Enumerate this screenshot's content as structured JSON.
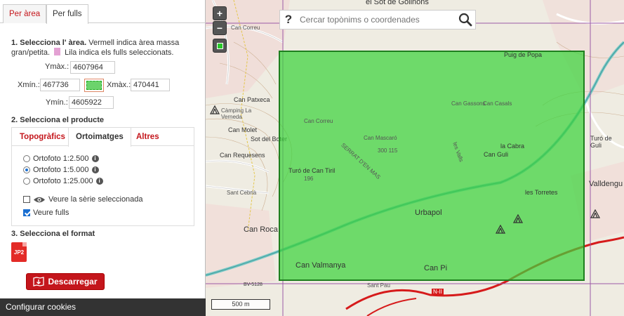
{
  "tabs": {
    "by_area": "Per àrea",
    "by_sheets": "Per fulls"
  },
  "step1": {
    "title": "1. Selecciona l' àrea.",
    "desc": "Vermell indica àrea massa gran/petita.",
    "desc2": "Lila indica els fulls seleccionats."
  },
  "coords": {
    "ymax_label": "Ymàx.:",
    "ymax": "4607964",
    "xmin_label": "Xmín.:",
    "xmin": "467736",
    "xmax_label": "Xmàx.:",
    "xmax": "470441",
    "ymin_label": "Ymín.:",
    "ymin": "4605922"
  },
  "step2": {
    "title": "2. Selecciona el producte"
  },
  "product_tabs": [
    "Topogràfics",
    "Ortoimatges",
    "Altres"
  ],
  "options": [
    {
      "label": "Ortofoto 1:2.500",
      "selected": false
    },
    {
      "label": "Ortofoto 1:5.000",
      "selected": true
    },
    {
      "label": "Ortofoto 1:25.000",
      "selected": false
    }
  ],
  "show_series": {
    "label": "Veure la sèrie seleccionada",
    "checked": false
  },
  "show_sheets": {
    "label": "Veure fulls",
    "checked": true
  },
  "step3": {
    "title": "3. Selecciona el format"
  },
  "format": {
    "label": "JP2"
  },
  "download": {
    "label": "Descarregar"
  },
  "cookies": {
    "label": "Configurar cookies"
  },
  "map": {
    "zoom_in": "+",
    "zoom_out": "−",
    "search_placeholder": "Cercar topònims o coordenades",
    "search_q": "?",
    "scale": "500 m",
    "labels": {
      "top": "el Sot de Golinons",
      "can_patxeca": "Can Patxeca",
      "camping_verneda": "Càmping La Verneda",
      "can_molet": "Can Molet",
      "sot_boter": "Sot del Boter",
      "can_requesens": "Can Requesens",
      "sant_cebrià": "Sant Cebrià",
      "can_roca": "Can Roca",
      "can_valmanya": "Can Valmanya",
      "can_pi": "Can Pi",
      "urbapol": "Urbapol",
      "turo_tiril": "Turó de Can Tiril",
      "turo_tiril_h": "196",
      "la_cabra": "la Cabra",
      "les_torretes": "les Torretes",
      "can_guli": "Can Guli",
      "puig_popa": "Puig de Popa",
      "vallcorrent": "Valldengu",
      "turo_guli": "Turó de Guli",
      "can_mascaro": "Can Mascaró",
      "serrat": "SERRAT D'EN MAS",
      "num_300": "300 115",
      "can_gassons": "Can Gassons",
      "can_casals": "Can Casals",
      "can_correu": "Can Correu",
      "les_valls": "les Valls",
      "road_bv": "BV-5128",
      "road_n2": "N-II",
      "sant_pau": "Sant Pau"
    }
  },
  "colors": {
    "accent": "#c4161c",
    "selection": "#3cd23c",
    "selection_border": "#1e7e1e",
    "grid_purple": "#9b5aa6"
  }
}
